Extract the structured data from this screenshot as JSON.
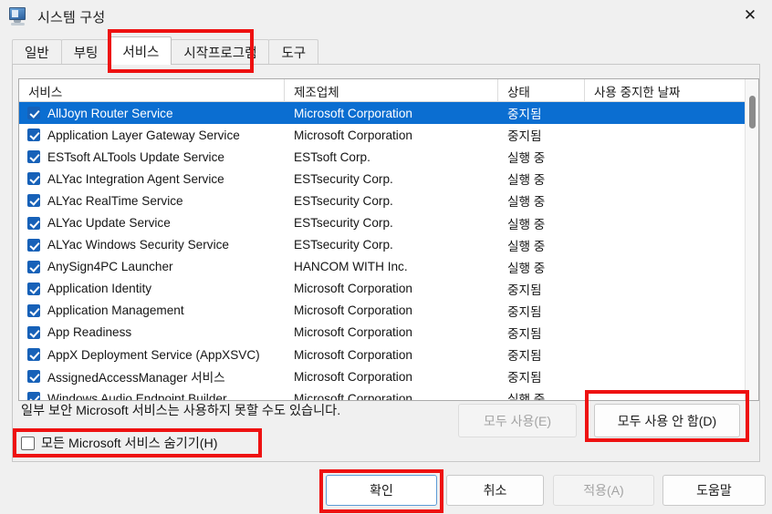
{
  "window": {
    "title": "시스템 구성",
    "icon": "system-configuration-icon",
    "close_label": "✕"
  },
  "tabs": [
    {
      "label": "일반",
      "active": false
    },
    {
      "label": "부팅",
      "active": false
    },
    {
      "label": "서비스",
      "active": true
    },
    {
      "label": "시작프로그램",
      "active": false
    },
    {
      "label": "도구",
      "active": false
    }
  ],
  "table": {
    "columns": [
      "서비스",
      "제조업체",
      "상태",
      "사용 중지한 날짜"
    ],
    "rows": [
      {
        "checked": true,
        "name": "AllJoyn Router Service",
        "maker": "Microsoft Corporation",
        "status": "중지됨",
        "date": "",
        "selected": true
      },
      {
        "checked": true,
        "name": "Application Layer Gateway Service",
        "maker": "Microsoft Corporation",
        "status": "중지됨",
        "date": "",
        "selected": false
      },
      {
        "checked": true,
        "name": "ESTsoft ALTools Update Service",
        "maker": "ESTsoft Corp.",
        "status": "실행 중",
        "date": "",
        "selected": false
      },
      {
        "checked": true,
        "name": "ALYac Integration Agent Service",
        "maker": "ESTsecurity Corp.",
        "status": "실행 중",
        "date": "",
        "selected": false
      },
      {
        "checked": true,
        "name": "ALYac RealTime Service",
        "maker": "ESTsecurity Corp.",
        "status": "실행 중",
        "date": "",
        "selected": false
      },
      {
        "checked": true,
        "name": "ALYac Update Service",
        "maker": "ESTsecurity Corp.",
        "status": "실행 중",
        "date": "",
        "selected": false
      },
      {
        "checked": true,
        "name": "ALYac Windows Security Service",
        "maker": "ESTsecurity Corp.",
        "status": "실행 중",
        "date": "",
        "selected": false
      },
      {
        "checked": true,
        "name": "AnySign4PC Launcher",
        "maker": "HANCOM WITH Inc.",
        "status": "실행 중",
        "date": "",
        "selected": false
      },
      {
        "checked": true,
        "name": "Application Identity",
        "maker": "Microsoft Corporation",
        "status": "중지됨",
        "date": "",
        "selected": false
      },
      {
        "checked": true,
        "name": "Application Management",
        "maker": "Microsoft Corporation",
        "status": "중지됨",
        "date": "",
        "selected": false
      },
      {
        "checked": true,
        "name": "App Readiness",
        "maker": "Microsoft Corporation",
        "status": "중지됨",
        "date": "",
        "selected": false
      },
      {
        "checked": true,
        "name": "AppX Deployment Service (AppXSVC)",
        "maker": "Microsoft Corporation",
        "status": "중지됨",
        "date": "",
        "selected": false
      },
      {
        "checked": true,
        "name": "AssignedAccessManager 서비스",
        "maker": "Microsoft Corporation",
        "status": "중지됨",
        "date": "",
        "selected": false
      },
      {
        "checked": true,
        "name": "Windows Audio Endpoint Builder",
        "maker": "Microsoft Corporation",
        "status": "실행 중",
        "date": "",
        "selected": false
      }
    ]
  },
  "footer": {
    "note": "일부 보안 Microsoft 서비스는 사용하지 못할 수도 있습니다.",
    "hide_ms_checkbox_label": "모든 Microsoft 서비스 숨기기(H)",
    "hide_ms_checked": false,
    "enable_all_label": "모두 사용(E)",
    "enable_all_enabled": false,
    "disable_all_label": "모두 사용 안 함(D)",
    "disable_all_enabled": true,
    "ok_label": "확인",
    "cancel_label": "취소",
    "apply_label": "적용(A)",
    "apply_enabled": false,
    "help_label": "도움말"
  },
  "colors": {
    "selection_blue": "#0b6ed1",
    "annotation_red": "#ee1111",
    "checkbox_blue": "#1761b8",
    "default_button_border": "#5b9bd5"
  }
}
